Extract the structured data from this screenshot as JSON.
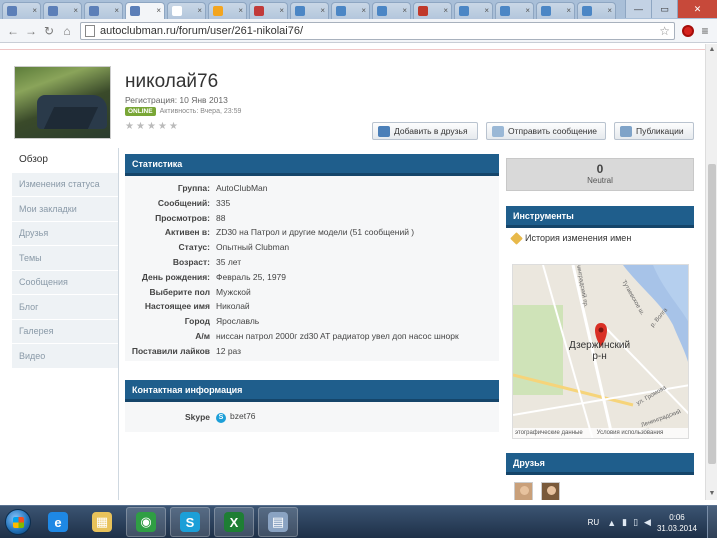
{
  "browser": {
    "tab_count": 15,
    "tab_favicons": [
      "#5c7fb8",
      "#5c7fb8",
      "#5c7fb8",
      "#5c7fb8",
      "#ffffff",
      "#f3a51f",
      "#c13a3a",
      "#4b86c5",
      "#4b86c5",
      "#4b86c5",
      "#c0392b",
      "#4b86c5",
      "#4b86c5",
      "#4b86c5",
      "#4b86c5"
    ],
    "active_tab": 3,
    "url": "autoclubman.ru/forum/user/261-nikolai76/"
  },
  "profile": {
    "username": "николай76",
    "registration": "Регистрация: 10 Янв 2013",
    "online_badge": "ONLINE",
    "activity": "Активность: Вчера, 23:59",
    "rating_stars": 5,
    "buttons": {
      "add_friend": "Добавить в друзья",
      "send_message": "Отправить сообщение",
      "publications": "Публикации"
    }
  },
  "nav": {
    "items": [
      "Обзор",
      "Изменения статуса",
      "Мои закладки",
      "Друзья",
      "Темы",
      "Сообщения",
      "Блог",
      "Галерея",
      "Видео"
    ],
    "active": 0
  },
  "stats": {
    "title": "Статистика",
    "rows": [
      {
        "label": "Группа:",
        "value": "AutoClubMan"
      },
      {
        "label": "Сообщений:",
        "value": "335"
      },
      {
        "label": "Просмотров:",
        "value": "88"
      },
      {
        "label": "Активен в:",
        "value": "ZD30 на Патрол и другие модели (51 сообщений )"
      },
      {
        "label": "Статус:",
        "value": "Опытный Clubman"
      },
      {
        "label": "Возраст:",
        "value": "35 лет"
      },
      {
        "label": "День рождения:",
        "value": "Февраль 25, 1979"
      },
      {
        "label": "Выберите пол",
        "value": "Мужской"
      },
      {
        "label": "Настоящее имя",
        "value": "Николай"
      },
      {
        "label": "Город",
        "value": "Ярославль"
      },
      {
        "label": "А/м",
        "value": "ниссан патрол 2000г zd30 AT радиатор увел доп насос шнорк"
      },
      {
        "label": "Поставили лайков",
        "value": "12 раз"
      }
    ]
  },
  "contact": {
    "title": "Контактная информация",
    "skype_label": "Skype",
    "skype_value": "bzet76"
  },
  "reputation": {
    "value": "0",
    "label": "Neutral"
  },
  "tools": {
    "title": "Инструменты",
    "name_history": "История изменения имен"
  },
  "map": {
    "district_line1": "Дзержинский",
    "district_line2": "р-н",
    "footer_left": "этографические данные",
    "footer_right": "Условия использования",
    "streets": [
      "Ленинградский пр.",
      "р. Волга",
      "Тутаевское ш.",
      "ул. Громова",
      "Ленинградский пр."
    ]
  },
  "friends": {
    "title": "Друзья",
    "count": 2
  },
  "taskbar": {
    "apps": [
      {
        "name": "ie",
        "color": "#1e88e5",
        "glyph": "e",
        "open": false
      },
      {
        "name": "explorer",
        "color": "#e8c25a",
        "glyph": "▦",
        "open": false
      },
      {
        "name": "chrome",
        "color": "#2f9e44",
        "glyph": "◉",
        "open": true
      },
      {
        "name": "skype",
        "color": "#1c9fd8",
        "glyph": "S",
        "open": true
      },
      {
        "name": "excel",
        "color": "#1e7e34",
        "glyph": "X",
        "open": true
      },
      {
        "name": "calculator",
        "color": "#8aa3c2",
        "glyph": "▤",
        "open": true
      }
    ],
    "language": "RU",
    "time": "0:06",
    "date": "31.03.2014"
  }
}
